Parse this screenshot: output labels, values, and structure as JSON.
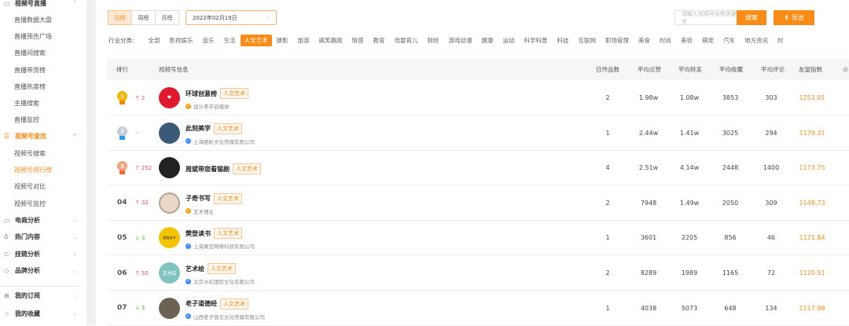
{
  "sidebar": {
    "groups": [
      {
        "label": "视频号直播",
        "icon": "live-icon",
        "items": [
          "直播数据大盘",
          "直播预告广场",
          "直播间搜索",
          "直播带货榜",
          "直播热度榜",
          "主播搜索",
          "直播监控"
        ]
      },
      {
        "label": "视频号查找",
        "icon": "search-list-icon",
        "active": true,
        "items": [
          "视频号搜索",
          "视频号排行榜",
          "视频号对比",
          "视频号监控"
        ],
        "active_item": 1
      },
      {
        "label": "电商分析",
        "icon": "monitor-icon"
      },
      {
        "label": "热门内容",
        "icon": "fire-icon"
      },
      {
        "label": "挂链分析",
        "icon": "link-icon"
      },
      {
        "label": "品牌分析",
        "icon": "tag-icon"
      },
      {
        "label": "我的订阅",
        "icon": "subscribe-icon"
      },
      {
        "label": "我的收藏",
        "icon": "star-icon"
      }
    ]
  },
  "toolbar": {
    "periods": [
      "日榜",
      "周榜",
      "月榜"
    ],
    "active_period": 0,
    "date": "2022年02月19日",
    "search_placeholder": "请输入视频号名称关键字",
    "search_label": "搜索",
    "export_label": "导出"
  },
  "categories": {
    "label": "行业分类:",
    "items": [
      "全部",
      "影视娱乐",
      "音乐",
      "生活",
      "人文艺术",
      "摄影",
      "旅游",
      "搞笑趣闻",
      "情感",
      "教育",
      "母婴育儿",
      "财经",
      "游戏动漫",
      "健康",
      "运动",
      "科学科普",
      "科技",
      "互联网",
      "职场管理",
      "美食",
      "时尚",
      "美妆",
      "萌宠",
      "汽车",
      "地方资讯",
      "时"
    ],
    "active": 4
  },
  "table": {
    "headers": [
      "排行",
      "视频号信息",
      "日作品数",
      "平均点赞",
      "平均转发",
      "平均收藏",
      "平均评论",
      "友望指数"
    ],
    "rows": [
      {
        "rank": "1",
        "change": "2",
        "dir": "up",
        "name": "环球创意榜",
        "tag": "人文艺术",
        "desc": "设计美学自媒体",
        "verify": "orange",
        "works": "2",
        "likes": "1.98w",
        "shares": "1.08w",
        "favs": "3853",
        "comments": "303",
        "index": "1251.01",
        "avatar_color": "#e0192e"
      },
      {
        "rank": "2",
        "change": "--",
        "dir": "flat",
        "name": "此刻美学",
        "tag": "人文艺术",
        "desc": "上海丽昕文化传媒有限公司",
        "verify": "blue",
        "works": "1",
        "likes": "2.44w",
        "shares": "1.41w",
        "favs": "3025",
        "comments": "294",
        "index": "1179.31",
        "avatar_color": "#3b5a78"
      },
      {
        "rank": "3",
        "change": "252",
        "dir": "up",
        "name": "周斌带您看锡剧",
        "tag": "人文艺术",
        "desc": "",
        "verify": "",
        "works": "4",
        "likes": "2.51w",
        "shares": "4.14w",
        "favs": "2448",
        "comments": "1400",
        "index": "1173.75",
        "avatar_color": "#222"
      },
      {
        "rank": "04",
        "change": "32",
        "dir": "up",
        "name": "子奇书写",
        "tag": "人文艺术",
        "desc": "艺术博主",
        "verify": "orange",
        "works": "2",
        "likes": "7948",
        "shares": "1.49w",
        "favs": "2050",
        "comments": "309",
        "index": "1148.73",
        "avatar_color": "#e9d8c8"
      },
      {
        "rank": "05",
        "change": "3",
        "dir": "down",
        "name": "樊登读书",
        "tag": "人文艺术",
        "desc": "上海黄豆网络科技有限公司",
        "verify": "blue",
        "works": "1",
        "likes": "3601",
        "shares": "2205",
        "favs": "856",
        "comments": "46",
        "index": "1121.84",
        "avatar_color": "#f5c400"
      },
      {
        "rank": "06",
        "change": "50",
        "dir": "up",
        "name": "艺术绘",
        "tag": "人文艺术",
        "desc": "北京水彩国际文化有限公司",
        "verify": "blue",
        "works": "2",
        "likes": "8289",
        "shares": "1989",
        "favs": "1165",
        "comments": "72",
        "index": "1120.51",
        "avatar_color": "#7fc4c0"
      },
      {
        "rank": "07",
        "change": "3",
        "dir": "down",
        "name": "老子道德经",
        "tag": "人文艺术",
        "desc": "山西老子微言文化传媒有限公司",
        "verify": "blue",
        "works": "1",
        "likes": "4038",
        "shares": "5073",
        "favs": "648",
        "comments": "134",
        "index": "1117.98",
        "avatar_color": "#6b6155"
      }
    ]
  },
  "avatar_texts": {
    "r5": "樊登读书",
    "r6": "艺术绘"
  },
  "colors": {
    "accent": "#fa8c16",
    "up": "#f5475e",
    "down": "#52c41a"
  }
}
